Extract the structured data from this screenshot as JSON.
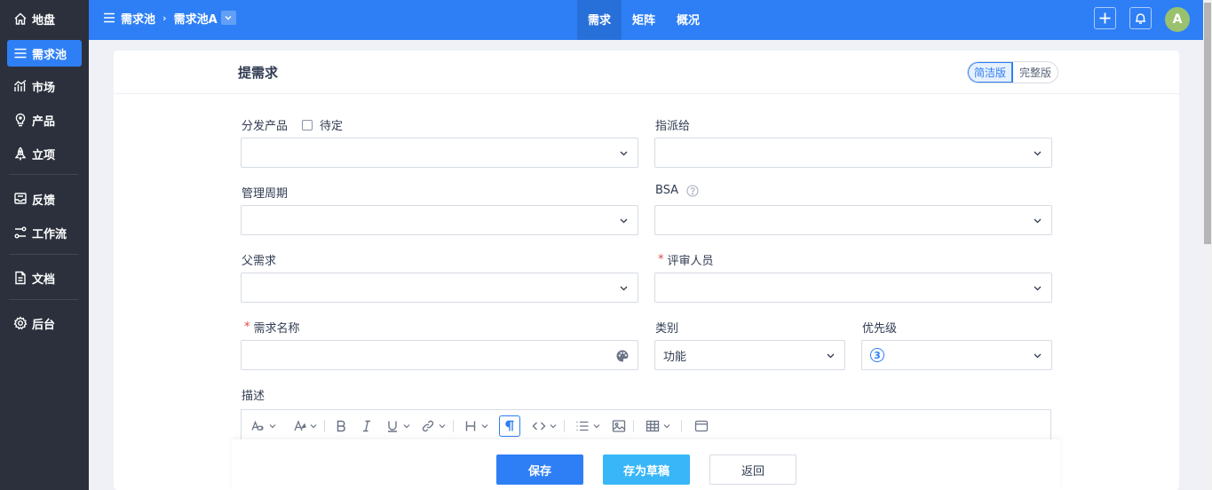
{
  "sidebar": {
    "items": [
      {
        "label": "地盘",
        "icon": "home-icon"
      },
      {
        "label": "需求池",
        "icon": "list-icon",
        "active": true
      },
      {
        "label": "市场",
        "icon": "chart-icon"
      },
      {
        "label": "产品",
        "icon": "bulb-icon"
      },
      {
        "label": "立项",
        "icon": "rocket-icon"
      },
      {
        "label": "反馈",
        "icon": "feedback-icon"
      },
      {
        "label": "工作流",
        "icon": "workflow-icon"
      },
      {
        "label": "文档",
        "icon": "document-icon"
      },
      {
        "label": "后台",
        "icon": "gear-icon"
      }
    ]
  },
  "header": {
    "breadcrumb": {
      "root": "需求池",
      "current": "需求池A"
    },
    "tabs": [
      {
        "label": "需求",
        "active": true
      },
      {
        "label": "矩阵"
      },
      {
        "label": "概况"
      }
    ],
    "avatar": "A"
  },
  "panel": {
    "title": "提需求",
    "modes": [
      {
        "label": "简洁版",
        "active": true
      },
      {
        "label": "完整版"
      }
    ]
  },
  "form": {
    "product": {
      "label": "分发产品",
      "checkbox_label": "待定",
      "value": ""
    },
    "assignee": {
      "label": "指派给",
      "value": ""
    },
    "cycle": {
      "label": "管理周期",
      "value": ""
    },
    "bsa": {
      "label": "BSA",
      "value": ""
    },
    "parent": {
      "label": "父需求",
      "value": ""
    },
    "reviewer": {
      "label": "评审人员",
      "required": "*",
      "value": ""
    },
    "name": {
      "label": "需求名称",
      "required": "*",
      "value": ""
    },
    "category": {
      "label": "类别",
      "value": "功能"
    },
    "priority": {
      "label": "优先级",
      "value": "3"
    },
    "description": {
      "label": "描述"
    }
  },
  "footer": {
    "save": "保存",
    "draft": "存为草稿",
    "back": "返回"
  },
  "colors": {
    "primary": "#2e7ff5",
    "sidebar": "#2b303c",
    "required": "#e64545"
  }
}
